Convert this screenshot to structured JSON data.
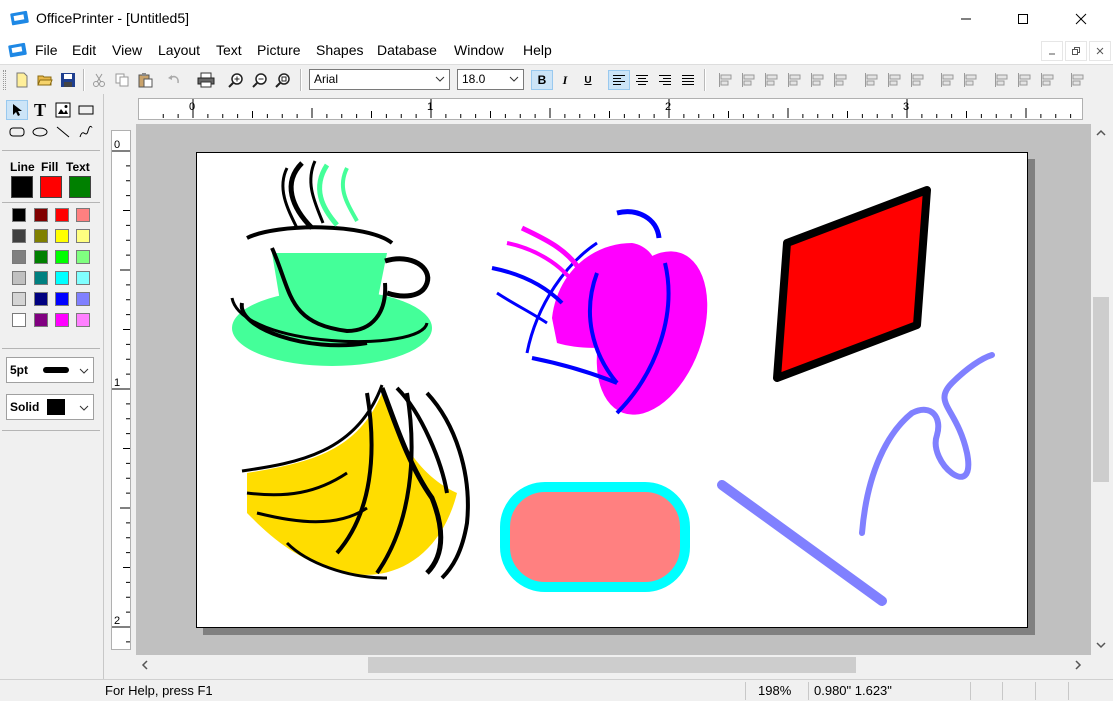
{
  "app": {
    "title": "OfficePrinter - [Untitled5]"
  },
  "menu": [
    "File",
    "Edit",
    "View",
    "Layout",
    "Text",
    "Picture",
    "Shapes",
    "Database",
    "Window",
    "Help"
  ],
  "toolbar": {
    "font_name": "Arial",
    "font_size": "18.0",
    "bold": "B",
    "italic": "I",
    "underline": "U",
    "active_alignment": "align-left"
  },
  "toolbox": {
    "headings": [
      "Line",
      "Fill",
      "Text"
    ],
    "line_color": "#000000",
    "fill_color": "#ff0000",
    "text_color": "#008000",
    "palette": [
      [
        "#000000",
        "#800000",
        "#ff0000",
        "#ff8080"
      ],
      [
        "#404040",
        "#808000",
        "#ffff00",
        "#ffff80"
      ],
      [
        "#808080",
        "#008000",
        "#00ff00",
        "#80ff80"
      ],
      [
        "#c0c0c0",
        "#008080",
        "#00ffff",
        "#80ffff"
      ],
      [
        "#d4d4d4",
        "#000080",
        "#0000ff",
        "#8080ff"
      ],
      [
        "#ffffff",
        "#800080",
        "#ff00ff",
        "#ff80ff"
      ]
    ],
    "line_width": "5pt",
    "line_style": "Solid"
  },
  "rulers": {
    "horizontal_labels": [
      "0",
      "1",
      "2",
      "3"
    ],
    "vertical_labels": [
      "0",
      "1",
      "2"
    ]
  },
  "canvas": {
    "objects": [
      {
        "name": "coffee-cup-clipart",
        "colors": [
          "#44ff99",
          "#000000"
        ]
      },
      {
        "name": "tipped-cup-clipart",
        "colors": [
          "#ff00ff",
          "#0000ff"
        ]
      },
      {
        "name": "red-parallelogram",
        "colors": [
          "#ff0000",
          "#000000"
        ]
      },
      {
        "name": "freehand-curve",
        "colors": [
          "#8080ff"
        ]
      },
      {
        "name": "bananas-clipart",
        "colors": [
          "#ffdd00",
          "#000000"
        ]
      },
      {
        "name": "rounded-rectangle",
        "colors": [
          "#ff8080",
          "#00ffff"
        ]
      },
      {
        "name": "diagonal-line",
        "colors": [
          "#8080ff"
        ]
      }
    ]
  },
  "status": {
    "help": "For Help, press F1",
    "zoom": "198%",
    "position": "0.980\" 1.623\""
  }
}
